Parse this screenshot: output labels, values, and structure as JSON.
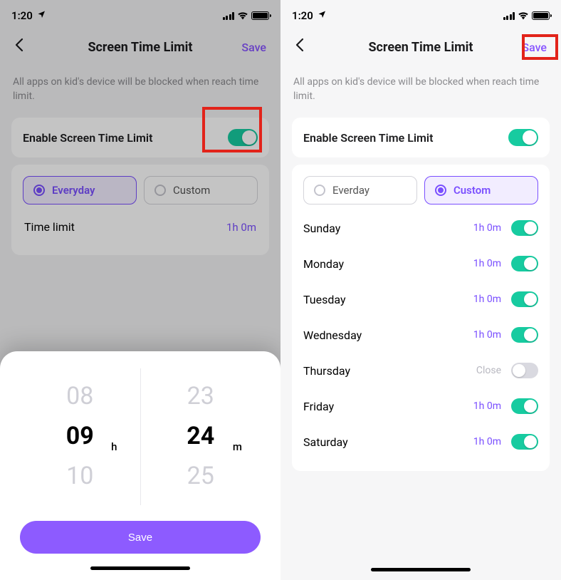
{
  "status": {
    "time": "1:20"
  },
  "nav": {
    "title": "Screen Time Limit",
    "save_label": "Save"
  },
  "subtitle": "All apps on kid's device will be blocked when reach time limit.",
  "enable": {
    "label": "Enable Screen Time Limit"
  },
  "seg": {
    "everyday_left": "Everyday",
    "everyday_right": "Everday",
    "custom": "Custom"
  },
  "time_limit": {
    "label": "Time limit",
    "value": "1h 0m"
  },
  "days": [
    {
      "name": "Sunday",
      "value": "1h 0m",
      "on": true
    },
    {
      "name": "Monday",
      "value": "1h 0m",
      "on": true
    },
    {
      "name": "Tuesday",
      "value": "1h 0m",
      "on": true
    },
    {
      "name": "Wednesday",
      "value": "1h 0m",
      "on": true
    },
    {
      "name": "Thursday",
      "value": "Close",
      "on": false
    },
    {
      "name": "Friday",
      "value": "1h 0m",
      "on": true
    },
    {
      "name": "Saturday",
      "value": "1h 0m",
      "on": true
    }
  ],
  "picker": {
    "hours": {
      "prev": "08",
      "current": "09",
      "next": "10",
      "unit": "h"
    },
    "minutes": {
      "prev": "23",
      "current": "24",
      "next": "25",
      "unit": "m"
    },
    "save_label": "Save"
  }
}
